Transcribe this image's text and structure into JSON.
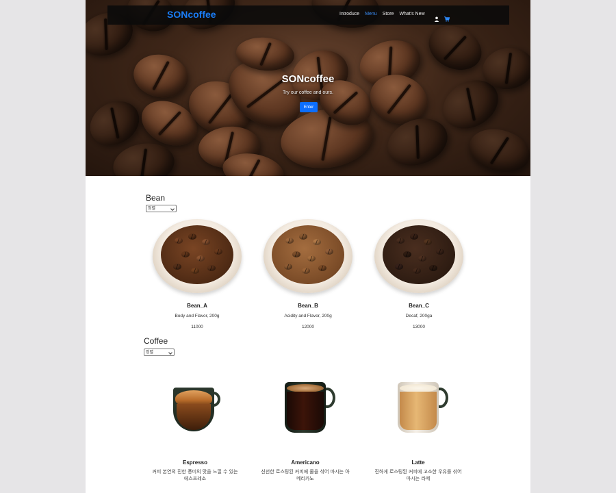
{
  "navbar": {
    "brand": "SONcoffee",
    "links": [
      "Introduce",
      "Menu",
      "Store",
      "What's New"
    ],
    "active_link": "Menu",
    "icons": [
      "user-icon",
      "cart-icon"
    ]
  },
  "hero": {
    "title": "SONcoffee",
    "subtitle": "Try our coffee and ours.",
    "button_label": "Enter"
  },
  "bean_section": {
    "title": "Bean",
    "sort_value": "정렬",
    "items": [
      {
        "name": "Bean_A",
        "desc": "Body and Flavor, 200g",
        "price": "11000",
        "roast_color": "#6a3b1e"
      },
      {
        "name": "Bean_B",
        "desc": "Acidity and Flavor, 200g",
        "price": "12000",
        "roast_color": "#8a5a32"
      },
      {
        "name": "Bean_C",
        "desc": "Decaf, 200ga",
        "price": "13000",
        "roast_color": "#3b2418"
      }
    ]
  },
  "coffee_section": {
    "title": "Coffee",
    "sort_value": "정렬",
    "items": [
      {
        "name": "Espresso",
        "desc": "커피 본연의 진한 풍미의 맛을 느낄 수 있는 에스프레소"
      },
      {
        "name": "Americano",
        "desc": "신선한 로스팅된 커피에 물을 섞어 마시는 아메리카노"
      },
      {
        "name": "Latte",
        "desc": "진하게 로스팅된 커피에 고소한 우유를 섞어 마시는 라떼"
      }
    ]
  },
  "colors": {
    "brand_blue": "#1a7cf5",
    "button_blue": "#0d6efd",
    "navbar_bg": "#0a0a0a",
    "outer_bg": "#e6e5e7"
  }
}
